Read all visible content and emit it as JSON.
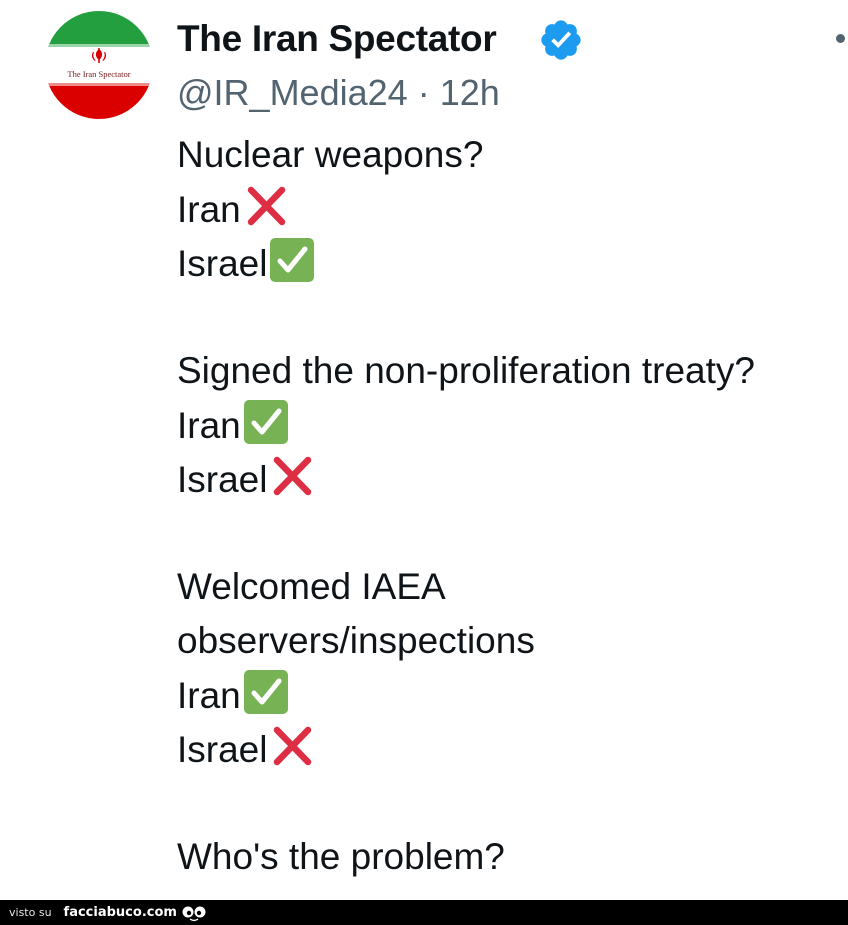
{
  "tweet": {
    "author": {
      "display_name": "The Iran Spectator",
      "handle": "@IR_Media24",
      "separator": "·",
      "time": "12h",
      "verified": true,
      "avatar_text": "The Iran Spectator"
    },
    "lines": [
      {
        "text": "Nuclear weapons?",
        "mark": ""
      },
      {
        "text": "Iran",
        "mark": "cross"
      },
      {
        "text": "Israel",
        "mark": "check"
      },
      {
        "text": "",
        "mark": ""
      },
      {
        "text": "Signed the non-proliferation treaty?",
        "mark": ""
      },
      {
        "text": "Iran",
        "mark": "check"
      },
      {
        "text": "Israel",
        "mark": "cross"
      },
      {
        "text": "",
        "mark": ""
      },
      {
        "text": "Welcomed IAEA",
        "mark": ""
      },
      {
        "text": "observers/inspections",
        "mark": ""
      },
      {
        "text": "Iran",
        "mark": "check"
      },
      {
        "text": "Israel",
        "mark": "cross"
      },
      {
        "text": "",
        "mark": ""
      },
      {
        "text": "Who's the problem?",
        "mark": ""
      }
    ]
  },
  "watermark": {
    "prefix": "visto su",
    "site": "facciabuco.com"
  },
  "colors": {
    "verified_blue": "#1d9bf0",
    "cross_red": "#dd2e44",
    "check_green": "#77b255",
    "flag_green": "#239f40",
    "flag_red": "#da0000"
  }
}
